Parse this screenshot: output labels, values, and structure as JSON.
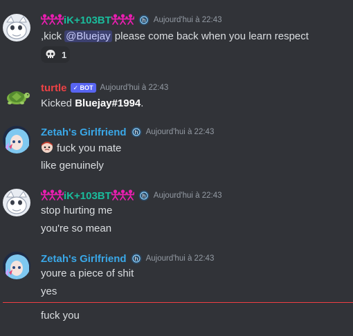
{
  "colors": {
    "background": "#313338",
    "username_pink_symbols": "#e91eb0",
    "username_teal": "#1abc9c",
    "username_red": "#ed4245",
    "username_blue": "#3aa8e8",
    "bot_badge": "#5865f2",
    "new_messages_divider": "#f23f43"
  },
  "messages": [
    {
      "author": "iK+103BT",
      "author_icon": "stick-figure-symbols",
      "timestamp": "Aujourd'hui à 22:43",
      "lines": [
        ",kick ",
        "@Bluejay",
        " please come back when you learn respect"
      ],
      "reaction": {
        "emoji": "skull-icon",
        "count": "1"
      }
    },
    {
      "author": "turtle",
      "badge": "✓ BOT",
      "timestamp": "Aujourd'hui à 22:43",
      "text_prefix": "Kicked ",
      "text_bold": "Bluejay#1994",
      "text_suffix": "."
    },
    {
      "author": "Zetah's Girlfriend",
      "timestamp": "Aujourd'hui à 22:43",
      "lines": [
        "fuck you mate",
        "like genuinely"
      ]
    },
    {
      "author": "iK+103BT",
      "timestamp": "Aujourd'hui à 22:43",
      "lines": [
        "stop hurting me",
        "you're so mean"
      ]
    },
    {
      "author": "Zetah's Girlfriend",
      "timestamp": "Aujourd'hui à 22:43",
      "lines": [
        "youre a piece of shit",
        "yes",
        "fuck you"
      ]
    }
  ]
}
